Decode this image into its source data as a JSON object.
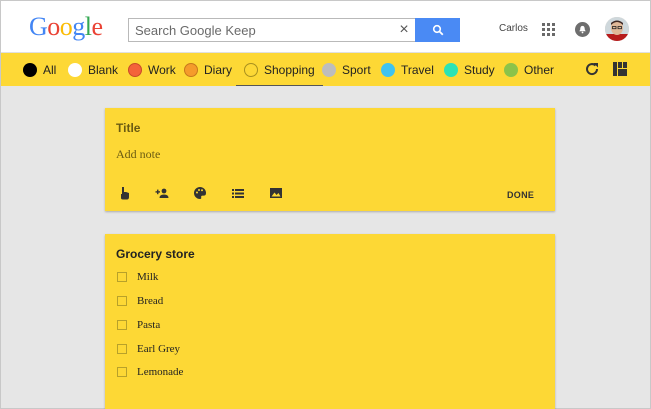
{
  "header": {
    "logo_letters": [
      {
        "ch": "G",
        "color": "#4285f4"
      },
      {
        "ch": "o",
        "color": "#ea4335"
      },
      {
        "ch": "o",
        "color": "#fbbc05"
      },
      {
        "ch": "g",
        "color": "#4285f4"
      },
      {
        "ch": "l",
        "color": "#34a853"
      },
      {
        "ch": "e",
        "color": "#ea4335"
      }
    ],
    "search_placeholder": "Search Google Keep",
    "clear_symbol": "×",
    "user_name": "Carlos"
  },
  "labels": [
    {
      "name": "All",
      "color": "#000000"
    },
    {
      "name": "Blank",
      "color": "#ffffff"
    },
    {
      "name": "Work",
      "color": "#f4623a"
    },
    {
      "name": "Diary",
      "color": "#f59b2b"
    },
    {
      "name": "Shopping",
      "color": "#fdd835",
      "active": true
    },
    {
      "name": "Sport",
      "color": "#bdbdbd"
    },
    {
      "name": "Travel",
      "color": "#3fc3f0"
    },
    {
      "name": "Study",
      "color": "#2de3b4"
    },
    {
      "name": "Other",
      "color": "#8bc34a"
    }
  ],
  "new_note": {
    "title_placeholder": "Title",
    "note_placeholder": "Add note",
    "tools": [
      "touch-icon",
      "add-person-icon",
      "palette-icon",
      "list-icon",
      "image-icon"
    ],
    "done_label": "DONE"
  },
  "list_note": {
    "title": "Grocery store",
    "items": [
      {
        "text": "Milk",
        "checked": false
      },
      {
        "text": "Bread",
        "checked": false
      },
      {
        "text": "Pasta",
        "checked": false
      },
      {
        "text": "Earl Grey",
        "checked": false
      },
      {
        "text": "Lemonade",
        "checked": false
      }
    ]
  },
  "colors": {
    "accent_yellow": "#fdd835",
    "search_button": "#4a8af4",
    "background": "#e6e6e6"
  }
}
